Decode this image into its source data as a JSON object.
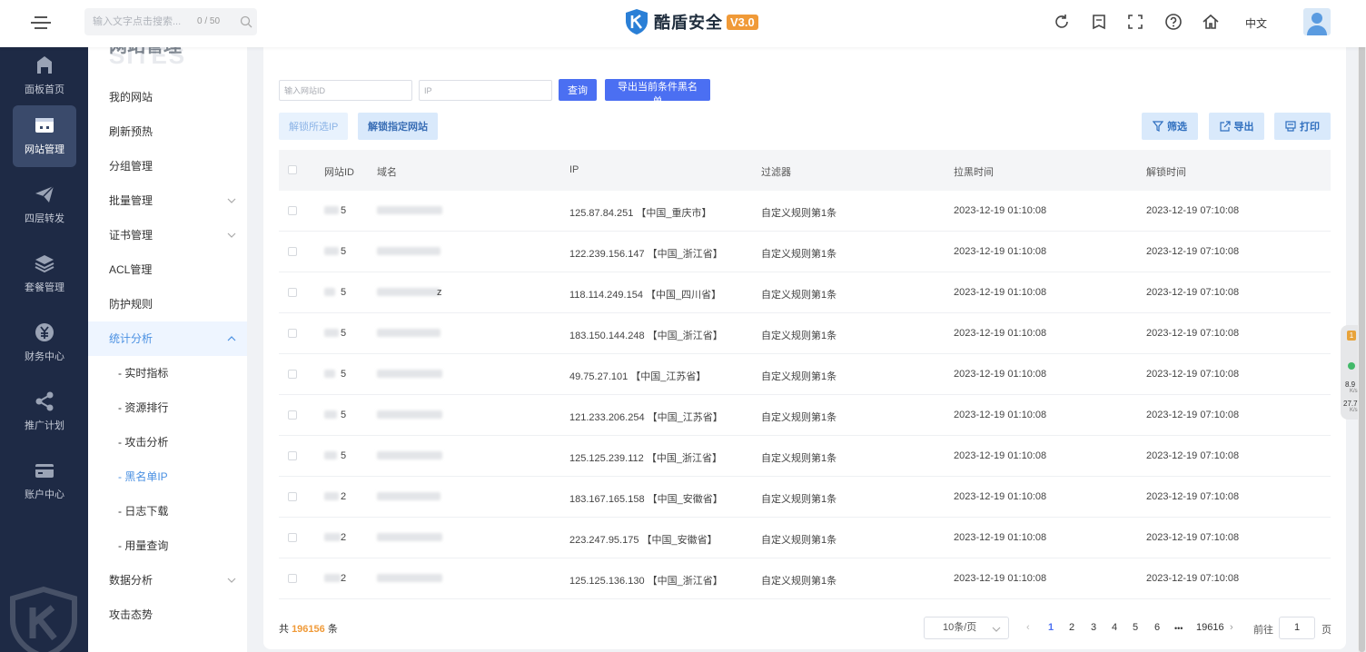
{
  "header": {
    "search_placeholder": "输入文字点击搜索...",
    "search_count": "0 / 50",
    "brand": "酷盾安全",
    "version": "V3.0",
    "lang": "中文"
  },
  "sidebar": {
    "items": [
      {
        "label": "面板首页"
      },
      {
        "label": "网站管理"
      },
      {
        "label": "四层转发"
      },
      {
        "label": "套餐管理"
      },
      {
        "label": "财务中心"
      },
      {
        "label": "推广计划"
      },
      {
        "label": "账户中心"
      }
    ]
  },
  "submenu": {
    "title": "网站管理",
    "title_bg": "SITES",
    "items": [
      "我的网站",
      "刷新预热",
      "分组管理",
      "批量管理",
      "证书管理",
      "ACL管理",
      "防护规则",
      "统计分析"
    ],
    "children": [
      "- 实时指标",
      "- 资源排行",
      "- 攻击分析",
      "- 黑名单IP",
      "- 日志下载",
      "- 用量查询"
    ],
    "after": [
      "数据分析",
      "攻击态势"
    ]
  },
  "filters": {
    "site_id_placeholder": "输入网站ID",
    "ip_placeholder": "IP",
    "query": "查询",
    "export_blacklist": "导出当前条件黑名单",
    "unlock_selected": "解锁所选IP",
    "unlock_site": "解锁指定网站",
    "filter": "筛选",
    "export": "导出",
    "print": "打印"
  },
  "table": {
    "headers": [
      "网站ID",
      "域名",
      "IP",
      "过滤器",
      "拉黑时间",
      "解锁时间"
    ],
    "rows": [
      {
        "id": "5",
        "domain": "",
        "ip": "125.87.84.251 【中国_重庆市】",
        "filter": "自定义规则第1条",
        "ban": "2023-12-19 01:10:08",
        "unlock": "2023-12-19 07:10:08"
      },
      {
        "id": "5",
        "domain": "",
        "ip": "122.239.156.147 【中国_浙江省】",
        "filter": "自定义规则第1条",
        "ban": "2023-12-19 01:10:08",
        "unlock": "2023-12-19 07:10:08"
      },
      {
        "id": "5",
        "domain": "z",
        "ip": "118.114.249.154 【中国_四川省】",
        "filter": "自定义规则第1条",
        "ban": "2023-12-19 01:10:08",
        "unlock": "2023-12-19 07:10:08"
      },
      {
        "id": "5",
        "domain": "",
        "ip": "183.150.144.248 【中国_浙江省】",
        "filter": "自定义规则第1条",
        "ban": "2023-12-19 01:10:08",
        "unlock": "2023-12-19 07:10:08"
      },
      {
        "id": "5",
        "domain": "",
        "ip": "49.75.27.101 【中国_江苏省】",
        "filter": "自定义规则第1条",
        "ban": "2023-12-19 01:10:08",
        "unlock": "2023-12-19 07:10:08"
      },
      {
        "id": "5",
        "domain": "",
        "ip": "121.233.206.254 【中国_江苏省】",
        "filter": "自定义规则第1条",
        "ban": "2023-12-19 01:10:08",
        "unlock": "2023-12-19 07:10:08"
      },
      {
        "id": "5",
        "domain": "",
        "ip": "125.125.239.112 【中国_浙江省】",
        "filter": "自定义规则第1条",
        "ban": "2023-12-19 01:10:08",
        "unlock": "2023-12-19 07:10:08"
      },
      {
        "id": "2",
        "domain": "",
        "ip": "183.167.165.158 【中国_安徽省】",
        "filter": "自定义规则第1条",
        "ban": "2023-12-19 01:10:08",
        "unlock": "2023-12-19 07:10:08"
      },
      {
        "id": "2",
        "domain": "",
        "ip": "223.247.95.175 【中国_安徽省】",
        "filter": "自定义规则第1条",
        "ban": "2023-12-19 01:10:08",
        "unlock": "2023-12-19 07:10:08"
      },
      {
        "id": "2",
        "domain": "",
        "ip": "125.125.136.130 【中国_浙江省】",
        "filter": "自定义规则第1条",
        "ban": "2023-12-19 01:10:08",
        "unlock": "2023-12-19 07:10:08"
      }
    ]
  },
  "footer": {
    "total_prefix": "共",
    "total": "196156",
    "total_suffix": "条",
    "page_size": "10条/页",
    "prev": "‹",
    "pages": [
      "1",
      "2",
      "3",
      "4",
      "5",
      "6"
    ],
    "ellipsis": "•••",
    "last_page": "19616",
    "next": "›",
    "goto_prefix": "前往",
    "goto_value": "1",
    "goto_suffix": "页"
  },
  "float_widget": {
    "badge": "1",
    "v1": "8.9",
    "u1": "K/s",
    "v2": "27.7",
    "u2": "K/s"
  },
  "colors": {
    "primary": "#4b6ff2",
    "orange": "#f09a38",
    "sidebar": "#1e2a45"
  }
}
